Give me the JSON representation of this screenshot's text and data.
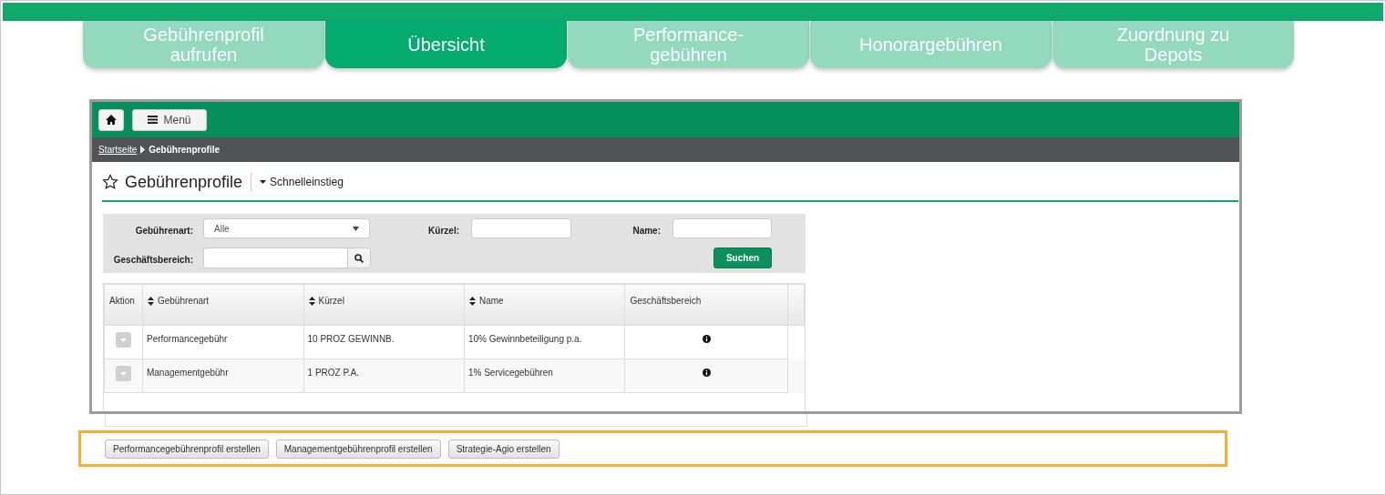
{
  "tabs": [
    {
      "label": "Gebührenprofil aufrufen",
      "selected": false
    },
    {
      "label": "Übersicht",
      "selected": true
    },
    {
      "label": "Performance-gebühren",
      "selected": false
    },
    {
      "label": "Honorargebühren",
      "selected": false
    },
    {
      "label": "Zuordnung zu Depots",
      "selected": false
    }
  ],
  "app": {
    "menu_button": "Menü",
    "breadcrumb": {
      "link": "Startseite",
      "current": "Gebührenprofile"
    },
    "page_title": "Gebührenprofile",
    "quick_entry": "Schnelleinstieg",
    "filters": {
      "fee_type_label": "Gebührenart:",
      "fee_type_value": "Alle",
      "short_label": "Kürzel:",
      "name_label": "Name:",
      "business_label": "Geschäftsbereich:",
      "search_button": "Suchen"
    },
    "table": {
      "columns": [
        "Aktion",
        "Gebührenart",
        "Kürzel",
        "Name",
        "Geschäftsbereich"
      ],
      "rows": [
        [
          "",
          "Performancegebühr",
          "10 PROZ GEWINNB.",
          "10% Gewinnbeteiligung p.a.",
          ""
        ],
        [
          "",
          "Managementgebühr",
          "1 PROZ P.A.",
          "1% Servicegebühren",
          ""
        ]
      ]
    }
  },
  "action_buttons": [
    "Performancegebührenprofil erstellen",
    "Managementgebührenprofil erstellen",
    "Strategie-Agio erstellen"
  ]
}
